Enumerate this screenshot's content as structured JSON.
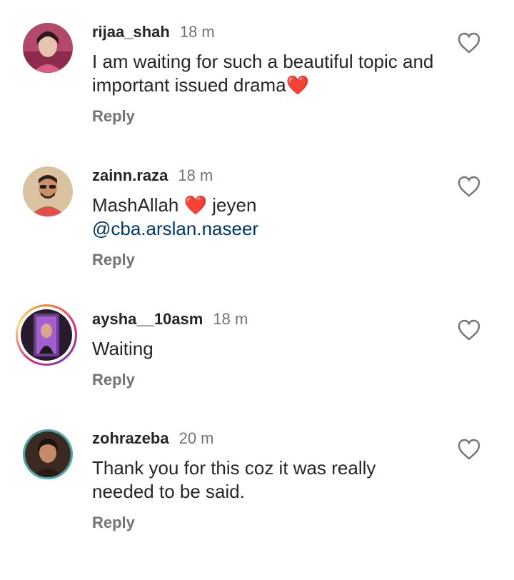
{
  "comments": [
    {
      "username": "rijaa_shah",
      "time": "18 m",
      "text": "I am waiting for such a beautiful topic and important issued drama",
      "emoji": "❤️",
      "reply": "Reply",
      "avatar_icon": "user-photo"
    },
    {
      "username": "zainn.raza",
      "time": "18 m",
      "text_before": "MashAllah",
      "emoji": "❤️",
      "text_after": "jeyen",
      "mention": "@cba.arslan.naseer",
      "reply": "Reply",
      "avatar_icon": "user-photo"
    },
    {
      "username": "aysha__10asm",
      "time": "18 m",
      "text": "Waiting",
      "reply": "Reply",
      "avatar_icon": "user-photo-story-ring"
    },
    {
      "username": "zohrazeba",
      "time": "20 m",
      "text": "Thank you for this coz it was really needed to be said.",
      "reply": "Reply",
      "avatar_icon": "user-photo"
    }
  ],
  "like_icon": "heart-outline-icon",
  "colors": {
    "text": "#262626",
    "secondary": "#737373",
    "mention": "#00376b",
    "heart": "#ed1c24"
  }
}
